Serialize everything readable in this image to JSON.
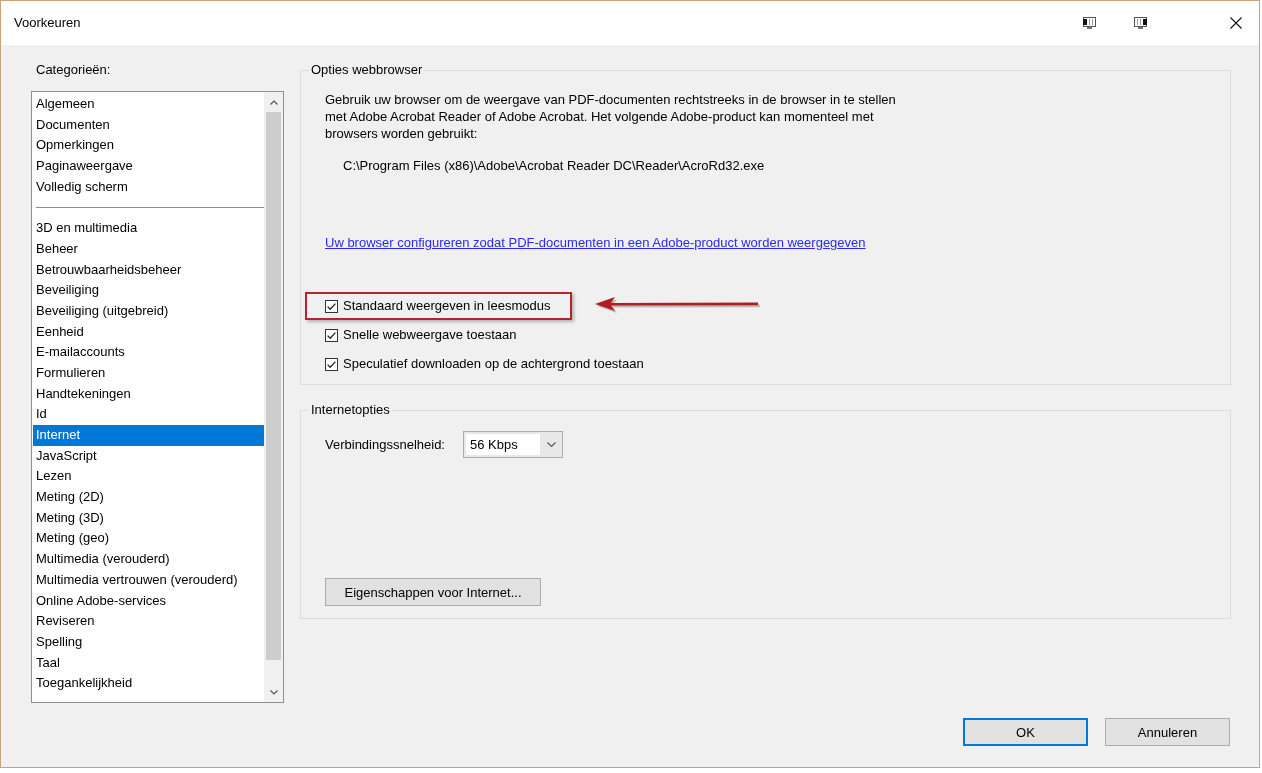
{
  "window": {
    "title": "Voorkeuren"
  },
  "categories": {
    "label": "Categorieën:",
    "groups": [
      {
        "items": [
          {
            "label": "Algemeen",
            "selected": false
          },
          {
            "label": "Documenten",
            "selected": false
          },
          {
            "label": "Opmerkingen",
            "selected": false
          },
          {
            "label": "Paginaweergave",
            "selected": false
          },
          {
            "label": "Volledig scherm",
            "selected": false
          }
        ]
      },
      {
        "items": [
          {
            "label": "3D en multimedia",
            "selected": false
          },
          {
            "label": "Beheer",
            "selected": false
          },
          {
            "label": "Betrouwbaarheidsbeheer",
            "selected": false
          },
          {
            "label": "Beveiliging",
            "selected": false
          },
          {
            "label": "Beveiliging (uitgebreid)",
            "selected": false
          },
          {
            "label": "Eenheid",
            "selected": false
          },
          {
            "label": "E-mailaccounts",
            "selected": false
          },
          {
            "label": "Formulieren",
            "selected": false
          },
          {
            "label": "Handtekeningen",
            "selected": false
          },
          {
            "label": "Id",
            "selected": false
          },
          {
            "label": "Internet",
            "selected": true
          },
          {
            "label": "JavaScript",
            "selected": false
          },
          {
            "label": "Lezen",
            "selected": false
          },
          {
            "label": "Meting (2D)",
            "selected": false
          },
          {
            "label": "Meting (3D)",
            "selected": false
          },
          {
            "label": "Meting (geo)",
            "selected": false
          },
          {
            "label": "Multimedia (verouderd)",
            "selected": false
          },
          {
            "label": "Multimedia vertrouwen (verouderd)",
            "selected": false
          },
          {
            "label": "Online Adobe-services",
            "selected": false
          },
          {
            "label": "Reviseren",
            "selected": false
          },
          {
            "label": "Spelling",
            "selected": false
          },
          {
            "label": "Taal",
            "selected": false
          },
          {
            "label": "Toegankelijkheid",
            "selected": false
          }
        ]
      }
    ]
  },
  "web_browser_options": {
    "title": "Opties webbrowser",
    "description": "Gebruik uw browser om de weergave van PDF-documenten rechtstreeks in de browser in te stellen met Adobe Acrobat Reader of Adobe Acrobat. Het volgende Adobe-product kan momenteel met browsers worden gebruikt:",
    "product_path": "C:\\Program Files (x86)\\Adobe\\Acrobat Reader DC\\Reader\\AcroRd32.exe",
    "link": "Uw browser configureren zodat PDF-documenten in een Adobe-product worden weergegeven",
    "options": [
      {
        "label": "Standaard weergeven in leesmodus",
        "checked": true,
        "highlighted": true
      },
      {
        "label": "Snelle webweergave toestaan",
        "checked": true,
        "highlighted": false
      },
      {
        "label": "Speculatief downloaden op de achtergrond toestaan",
        "checked": true,
        "highlighted": false
      }
    ]
  },
  "internet_options": {
    "title": "Internetopties",
    "speed": {
      "label": "Verbindingssnelheid:",
      "value": "56 Kbps"
    },
    "button": "Eigenschappen voor Internet..."
  },
  "buttons": [
    {
      "label": "OK",
      "default": true
    },
    {
      "label": "Annuleren",
      "default": false
    }
  ]
}
